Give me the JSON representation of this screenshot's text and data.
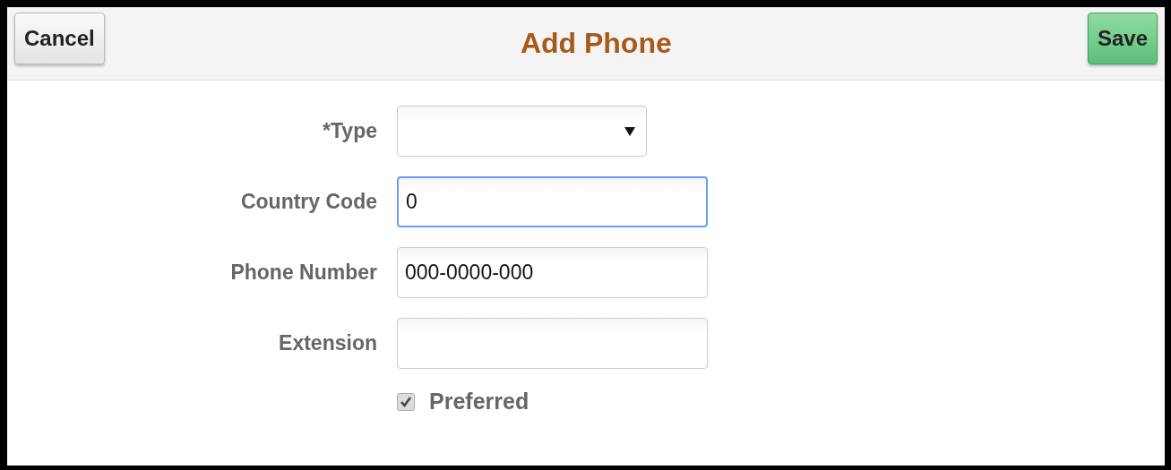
{
  "header": {
    "title": "Add Phone",
    "cancel_button": "Cancel",
    "save_button": "Save"
  },
  "fields": [
    {
      "label": "*Type",
      "kind": "select",
      "focused": false
    },
    {
      "label": "Country Code",
      "kind": "text",
      "value": "0",
      "focused": true
    },
    {
      "label": "Phone Number",
      "kind": "text",
      "value": "000-0000-000",
      "focused": false
    },
    {
      "label": "Extension",
      "kind": "text",
      "focused": false
    }
  ],
  "preferred": {
    "label": "Preferred",
    "checked": true
  }
}
